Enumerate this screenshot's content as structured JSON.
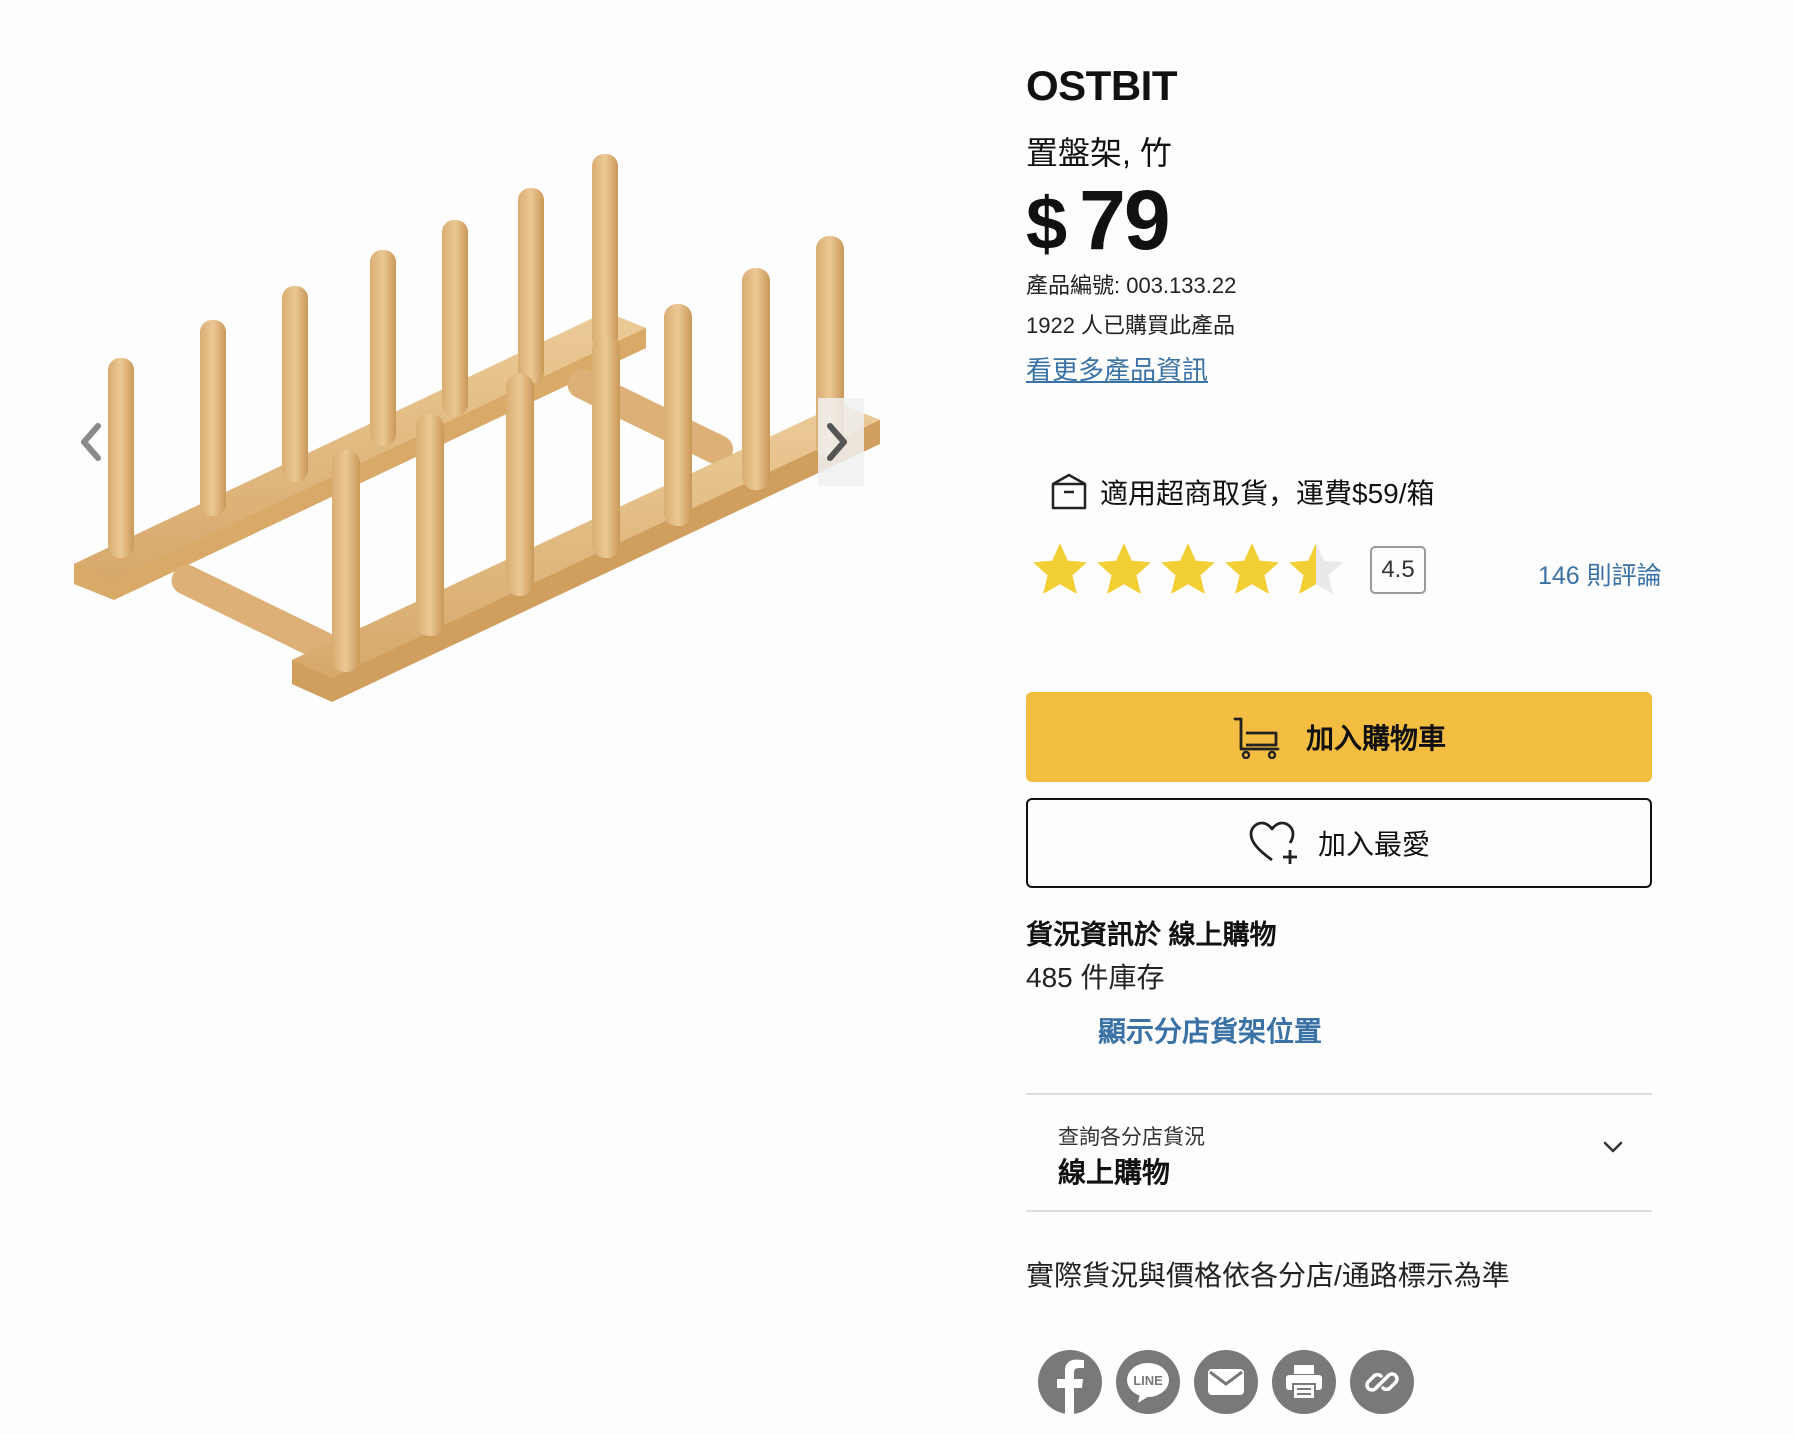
{
  "product": {
    "name": "OSTBIT",
    "description": "置盤架, 竹",
    "currency": "$",
    "price": "79",
    "article_number": "產品編號: 003.133.22",
    "purchases": "1922 人已購買此產品",
    "more_info_link": "看更多產品資訊"
  },
  "gallery": {
    "prev_icon": "chevron-left-icon",
    "next_icon": "chevron-right-icon"
  },
  "pickup": {
    "icon": "parcel-box-icon",
    "text": "適用超商取貨，運費$59/箱"
  },
  "rating": {
    "value": 4.5,
    "max": 5,
    "value_label": "4.5",
    "reviews_label": "146 則評論",
    "star_color": "#f3cf36"
  },
  "actions": {
    "add_to_cart": "加入購物車",
    "add_to_cart_icon": "shopping-cart-icon",
    "add_to_favourites": "加入最愛",
    "favourites_icon": "heart-plus-icon",
    "accent_color": "#f3bd41"
  },
  "stock": {
    "title": "貨況資訊於 線上購物",
    "count": "485 件庫存",
    "shelf_link": "顯示分店貨架位置"
  },
  "store_selector": {
    "label": "查詢各分店貨況",
    "value": "線上購物",
    "icon": "chevron-down-icon"
  },
  "disclaimer": "實際貨況與價格依各分店/通路標示為準",
  "share": [
    {
      "name": "facebook-icon"
    },
    {
      "name": "line-icon",
      "text": "LINE"
    },
    {
      "name": "email-icon"
    },
    {
      "name": "print-icon"
    },
    {
      "name": "link-icon"
    }
  ]
}
